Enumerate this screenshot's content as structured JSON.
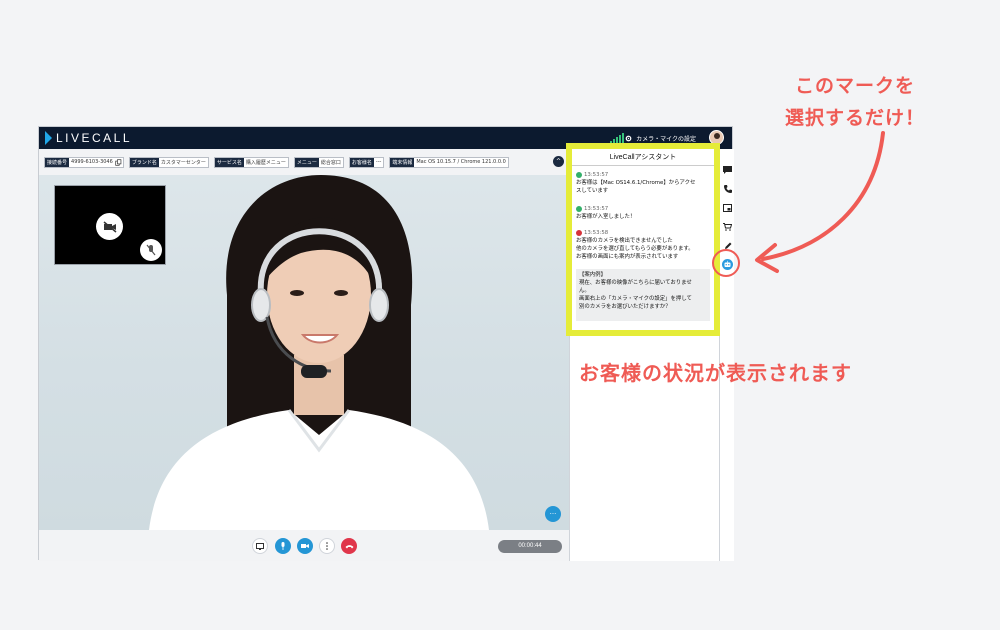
{
  "app": {
    "brand": "LIVECALL",
    "camera_settings_label": "カメラ・マイクの設定"
  },
  "info_chips": [
    {
      "key": "接続番号",
      "value": "4999-6103-3046"
    },
    {
      "key": "ブランド名",
      "value": "カスタマーセンター"
    },
    {
      "key": "サービス名",
      "value": "購入履歴メニュー"
    },
    {
      "key": "メニュー",
      "value": "総合窓口"
    },
    {
      "key": "お客様名",
      "value": "---"
    },
    {
      "key": "端末情報",
      "value": "Mac OS 10.15.7 / Chrome 121.0.0.0"
    }
  ],
  "call": {
    "timer": "00:00:44",
    "more_label": "···"
  },
  "assistant": {
    "title": "LiveCallアシスタント",
    "messages": [
      {
        "status": "ok",
        "time": "13:53:57",
        "text1": "お客様は【Mac OS14.6.1/Chrome】からアクセ",
        "text2": "スしています"
      },
      {
        "status": "ok",
        "time": "13:53:57",
        "text1": "お客様が入室しました！",
        "text2": ""
      },
      {
        "status": "error",
        "time": "13:53:58",
        "text1": "お客様のカメラを検出できませんでした",
        "text2": "他のカメラを選び直してもらう必要があります。",
        "text3": "お客様の画面にも案内が表示されています"
      }
    ],
    "guide": {
      "header": "【案内例】",
      "lines": [
        "現在、お客様の映像がこちらに届いておりませ",
        "ん。",
        "画面右上の「カメラ・マイクの設定」を押して",
        "別のカメラをお選びいただけますか？"
      ]
    }
  },
  "annotations": {
    "mark_line1": "このマークを",
    "mark_line2": "選択するだけ！",
    "status_text": "お客様の状況が表示されます"
  },
  "colors": {
    "accent": "#ef5b55",
    "highlight": "#e5ec39",
    "nav_dark": "#0c1a2f",
    "brand_blue": "#21a7e8"
  }
}
